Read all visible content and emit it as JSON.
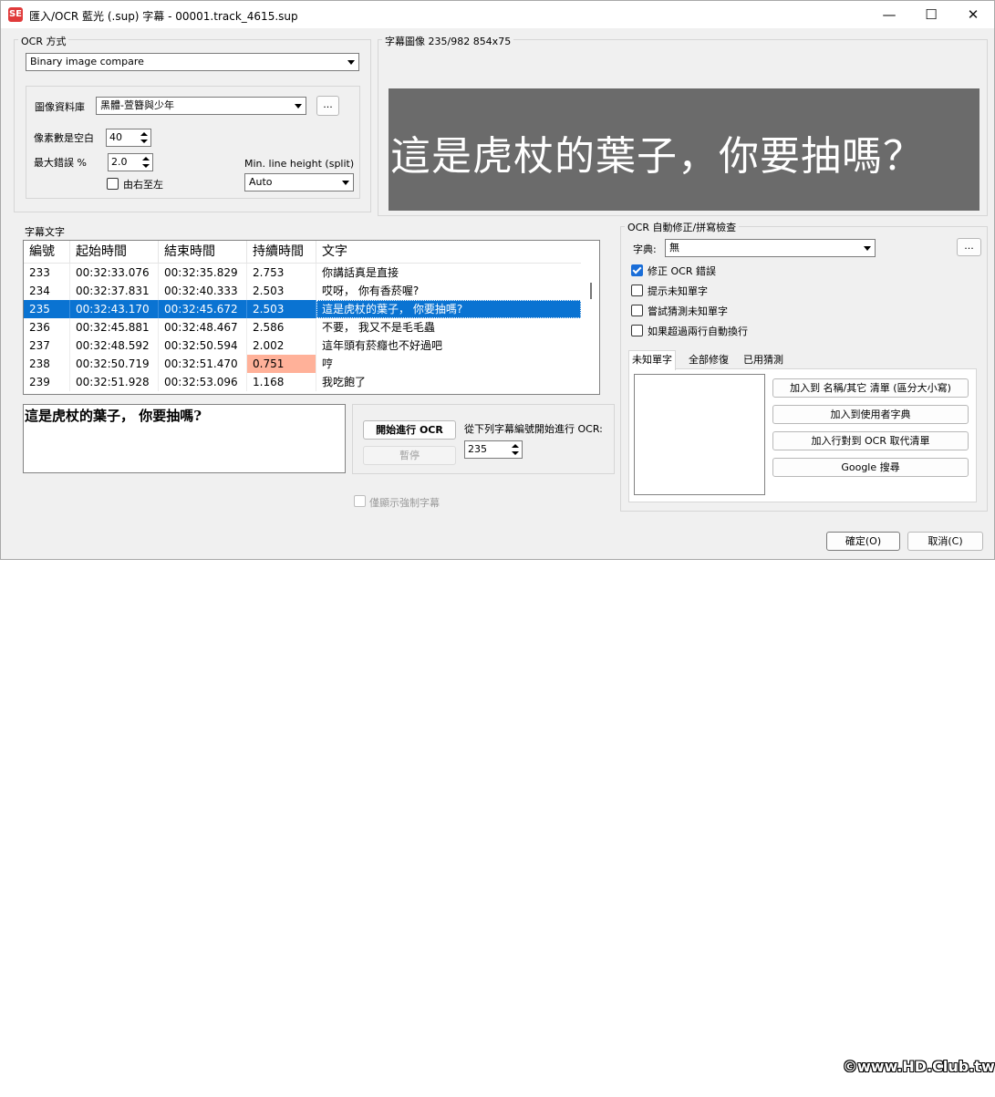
{
  "window": {
    "title": "匯入/OCR 藍光 (.sup) 字幕 - 00001.track_4615.sup",
    "minimize_glyph": "—",
    "maximize_glyph": "☐",
    "close_glyph": "✕",
    "app_icon_glyph": "SE"
  },
  "ocr_method": {
    "label": "OCR 方式",
    "method_value": "Binary image compare",
    "db_label": "圖像資料庫",
    "db_value": "黑體-萱簪與少年",
    "db_more": "...",
    "pixels_space_label": "像素數是空白",
    "pixels_space_value": "40",
    "max_error_label": "最大錯誤 %",
    "max_error_value": "2.0",
    "rtl_label": "由右至左",
    "rtl_checked": false,
    "min_line_label": "Min. line height (split)",
    "min_line_value": "Auto"
  },
  "subtitle_image": {
    "label": "字幕圖像 235/982   854x75",
    "text": "這是虎杖的葉子，你要抽嗎？"
  },
  "subtitle_text": {
    "label": "字幕文字",
    "columns": [
      "編號",
      "起始時間",
      "結束時間",
      "持續時間",
      "文字"
    ],
    "rows": [
      {
        "num": "233",
        "start": "00:32:33.076",
        "end": "00:32:35.829",
        "dur": "2.753",
        "text": "你講話真是直接"
      },
      {
        "num": "234",
        "start": "00:32:37.831",
        "end": "00:32:40.333",
        "dur": "2.503",
        "text": "哎呀，  你有香菸喔?"
      },
      {
        "num": "235",
        "start": "00:32:43.170",
        "end": "00:32:45.672",
        "dur": "2.503",
        "text": "這是虎杖的葉子，  你要抽嗎?"
      },
      {
        "num": "236",
        "start": "00:32:45.881",
        "end": "00:32:48.467",
        "dur": "2.586",
        "text": "不要，  我又不是毛毛蟲"
      },
      {
        "num": "237",
        "start": "00:32:48.592",
        "end": "00:32:50.594",
        "dur": "2.002",
        "text": "這年頭有菸癮也不好過吧"
      },
      {
        "num": "238",
        "start": "00:32:50.719",
        "end": "00:32:51.470",
        "dur": "0.751",
        "text": "哼"
      },
      {
        "num": "239",
        "start": "00:32:51.928",
        "end": "00:32:53.096",
        "dur": "1.168",
        "text": "我吃飽了"
      }
    ],
    "selected_index": 2,
    "warn_index": 5,
    "warn_color": "#ffb199",
    "select_color": "#0a73d2",
    "editor_text": "這是虎杖的葉子，  你要抽嗎?"
  },
  "ocr_controls": {
    "start_button": "開始進行 OCR",
    "pause_button": "暫停",
    "from_label": "從下列字幕編號開始進行 OCR:",
    "from_value": "235",
    "forced_only_label": "僅顯示強制字幕"
  },
  "autocorrect": {
    "label": "OCR 自動修正/拼寫檢查",
    "dict_label": "字典:",
    "dict_value": "無",
    "dict_more": "...",
    "fix_ocr_label": "修正 OCR 錯誤",
    "fix_ocr_checked": true,
    "prompt_unknown_label": "提示未知單字",
    "guess_unknown_label": "嘗試猜測未知單字",
    "auto_wrap_label": "如果超過兩行自動換行",
    "tabs": [
      "未知單字",
      "全部修復",
      "已用猜測"
    ],
    "buttons": {
      "add_names": "加入到 名稱/其它 清單 (區分大小寫)",
      "add_user_dict": "加入到使用者字典",
      "add_ocr_replace": "加入行對到 OCR 取代清單",
      "google": "Google 搜尋"
    }
  },
  "dialog": {
    "ok": "確定(O)",
    "cancel": "取消(C)"
  },
  "watermark": "©www.HD.Club.tw"
}
